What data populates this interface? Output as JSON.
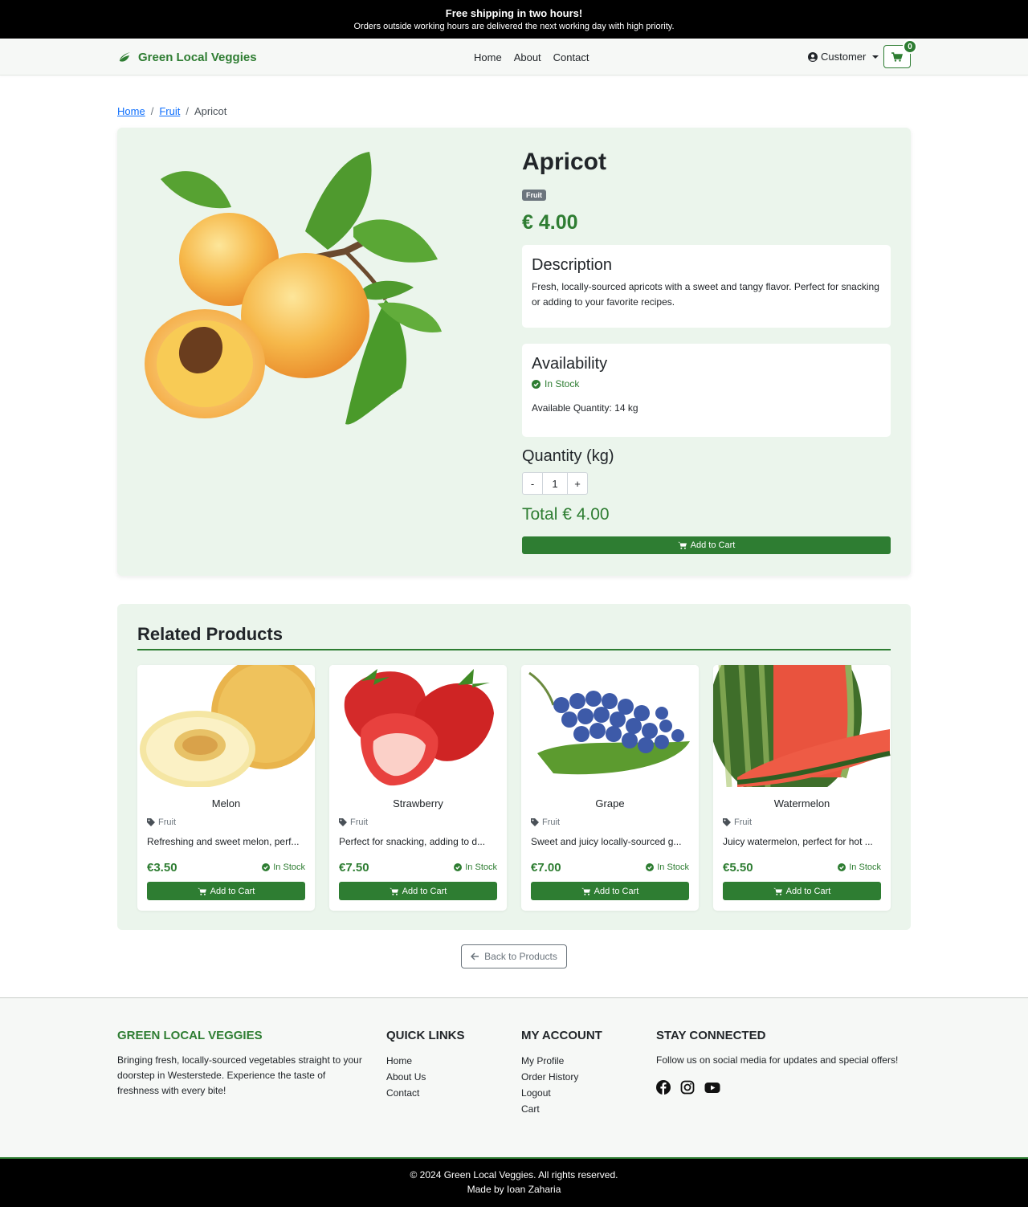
{
  "announcement": {
    "headline": "Free shipping in two hours!",
    "subline": "Orders outside working hours are delivered the next working day with high priority."
  },
  "navbar": {
    "brand": "Green Local Veggies",
    "links": [
      "Home",
      "About",
      "Contact"
    ],
    "user_menu": "Customer",
    "cart_count": "0"
  },
  "breadcrumb": [
    "Home",
    "Fruit",
    "Apricot"
  ],
  "product": {
    "name": "Apricot",
    "category": "Fruit",
    "price": "€ 4.00",
    "description_title": "Description",
    "description": "Fresh, locally-sourced apricots with a sweet and tangy flavor. Perfect for snacking or adding to your favorite recipes.",
    "availability_title": "Availability",
    "stock_status": "In Stock",
    "available_quantity": "Available Quantity: 14 kg",
    "quantity_label": "Quantity (kg)",
    "quantity_value": "1",
    "decrement": "-",
    "increment": "+",
    "total": "Total € 4.00",
    "add_to_cart": "Add to Cart"
  },
  "related": {
    "title": "Related Products",
    "items": [
      {
        "name": "Melon",
        "category": "Fruit",
        "description": "Refreshing and sweet melon, perf...",
        "price": "€3.50",
        "stock": "In Stock",
        "button": "Add to Cart"
      },
      {
        "name": "Strawberry",
        "category": "Fruit",
        "description": "Perfect for snacking, adding to d...",
        "price": "€7.50",
        "stock": "In Stock",
        "button": "Add to Cart"
      },
      {
        "name": "Grape",
        "category": "Fruit",
        "description": "Sweet and juicy locally-sourced g...",
        "price": "€7.00",
        "stock": "In Stock",
        "button": "Add to Cart"
      },
      {
        "name": "Watermelon",
        "category": "Fruit",
        "description": "Juicy watermelon, perfect for hot ...",
        "price": "€5.50",
        "stock": "In Stock",
        "button": "Add to Cart"
      }
    ]
  },
  "back_button": "Back to Products",
  "footer": {
    "brand": "GREEN LOCAL VEGGIES",
    "about": "Bringing fresh, locally-sourced vegetables straight to your doorstep in Westerstede. Experience the taste of freshness with every bite!",
    "quick_links_title": "QUICK LINKS",
    "quick_links": [
      "Home",
      "About Us",
      "Contact"
    ],
    "account_title": "MY ACCOUNT",
    "account_links": [
      "My Profile",
      "Order History",
      "Logout",
      "Cart"
    ],
    "social_title": "STAY CONNECTED",
    "social_text": "Follow us on social media for updates and special offers!",
    "social_icons": [
      "facebook-icon",
      "instagram-icon",
      "youtube-icon"
    ],
    "copyright": "© 2024 Green Local Veggies. All rights reserved.",
    "made_by": "Made by Ioan Zaharia"
  },
  "colors": {
    "brand_green": "#2e7d32",
    "panel_bg": "#ebf5ec",
    "announce_bg": "#000000"
  }
}
